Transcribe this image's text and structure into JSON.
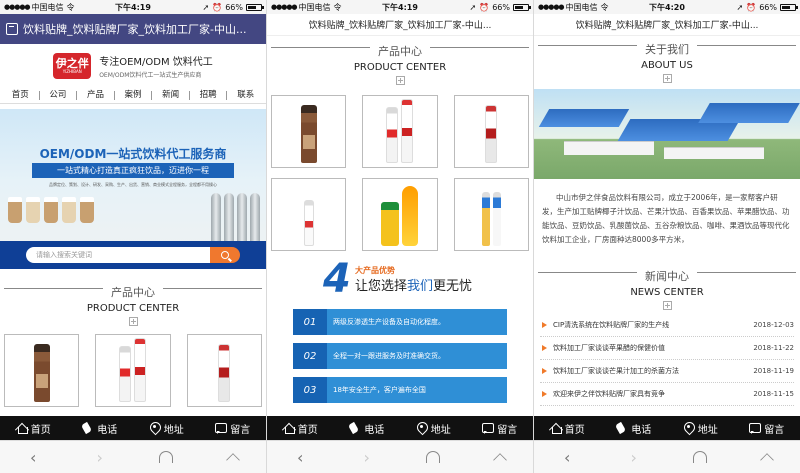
{
  "status": {
    "carrier": "中国电信",
    "wifi": "令",
    "battery": "66%",
    "times": [
      "下午4:19",
      "下午4:19",
      "下午4:20"
    ]
  },
  "title": "饮料贴牌_饮料贴牌厂家_饮料加工厂家-中山...",
  "brand": {
    "logo_text": "伊之伴",
    "logo_sub": "YIZHIBAN",
    "slogan": "专注OEM/ODM 饮料代工",
    "sub_slogan": "OEM/ODM饮料代工一站式生产供应商"
  },
  "nav": [
    "首页",
    "公司",
    "产品",
    "案例",
    "新闻",
    "招聘",
    "联系"
  ],
  "banner": {
    "headline": "OEM/ODM一站式饮料代工服务商",
    "subline": "一站式精心打造真正疯狂饮品，迈进你一程",
    "small": "品牌定位、策划、设计、研发、采购、生产、出货、营销、商业模式全程服务，全程都不用操心",
    "search_placeholder": "请输入搜索关键词"
  },
  "products": {
    "title_cn": "产品中心",
    "title_en": "PRODUCT CENTER"
  },
  "advantages": {
    "number": "4",
    "label": "大产品优势",
    "headline_a": "让您选择",
    "headline_b": "我们",
    "headline_c": "更无忧",
    "items": [
      {
        "num": "01",
        "text": "两级反渗透生产设备及自动化程度。"
      },
      {
        "num": "02",
        "text": "全程一对一跟进服务及时准确交货。"
      },
      {
        "num": "03",
        "text": "18年安全生产，客户遍布全国"
      }
    ]
  },
  "about": {
    "title_cn": "关于我们",
    "title_en": "ABOUT US",
    "text": "中山市伊之伴食品饮料有限公司，成立于2006年，是一家帮客户研发，生产加工贴牌椰子汁饮品、芒果汁饮品、百香果饮品、苹果醋饮品、功能饮品、豆奶饮品、乳酸菌饮品、五谷杂粮饮品、咖啡、果酒饮品等现代化饮料加工企业，厂房面种达8000多平方米，"
  },
  "news": {
    "title_cn": "新闻中心",
    "title_en": "NEWS CENTER",
    "items": [
      {
        "title": "CIP清洗系统在饮料贴牌厂家的生产线",
        "date": "2018-12-03"
      },
      {
        "title": "饮料加工厂家谈谈苹果醋的保健价值",
        "date": "2018-11-22"
      },
      {
        "title": "饮料加工厂家谈谈芒果汁加工的杀菌方法",
        "date": "2018-11-19"
      },
      {
        "title": "欢迎来伊之伴饮料贴牌厂家具有竞争",
        "date": "2018-11-15"
      }
    ]
  },
  "footer": {
    "home": "首页",
    "phone": "电话",
    "address": "地址",
    "message": "留言"
  },
  "browser": {
    "back": "‹",
    "forward": "›"
  }
}
